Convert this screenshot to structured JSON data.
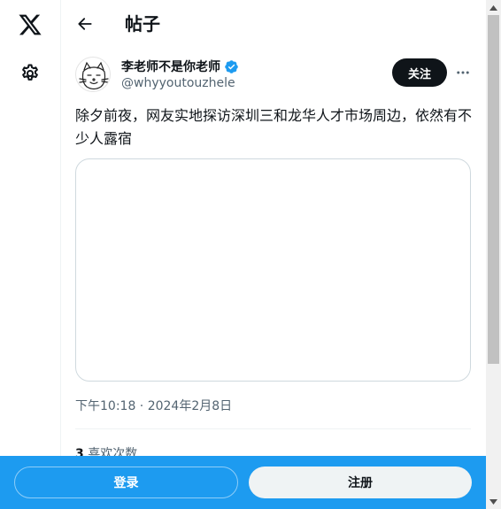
{
  "header": {
    "title": "帖子"
  },
  "post": {
    "author": {
      "name": "李老师不是你老师",
      "handle": "@whyyoutouzhele",
      "verified": true
    },
    "follow_label": "关注",
    "text": "除夕前夜，网友实地探访深圳三和龙华人才市场周边，依然有不少人露宿",
    "timestamp": "下午10:18 · 2024年2月8日",
    "likes": {
      "count": "3",
      "label": "喜欢次数"
    }
  },
  "bottom_bar": {
    "login_label": "登录",
    "signup_label": "注册"
  },
  "icons": {
    "logo": "x-logo-icon",
    "settings": "gear-icon",
    "back": "arrow-left-icon",
    "verified": "verified-badge-icon",
    "more": "more-horizontal-icon"
  },
  "colors": {
    "accent": "#1d9bf0",
    "text": "#0f1419",
    "muted": "#536471",
    "follow_button": "#0f1419"
  }
}
